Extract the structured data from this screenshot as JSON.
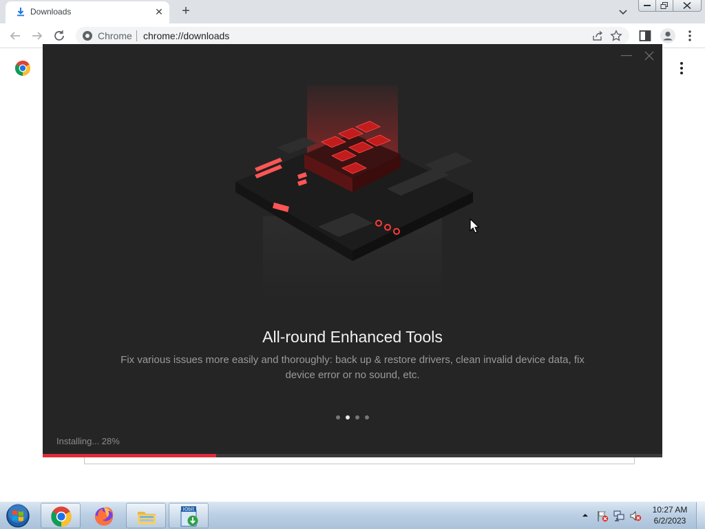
{
  "browser": {
    "tab": {
      "title": "Downloads",
      "icon": "download-icon"
    },
    "omnibox": {
      "chip": "Chrome",
      "url": "chrome://downloads"
    },
    "accent": "#1a73e8"
  },
  "installer": {
    "slide_title": "All-round Enhanced Tools",
    "slide_description": "Fix various issues more easily and thoroughly: back up & restore drivers, clean invalid device data, fix device error or no sound, etc.",
    "slides": {
      "count": 4,
      "active_index": 1
    },
    "status_text": "Installing... 28%",
    "progress": 0.28,
    "accent": "#e02c3a",
    "background": "#252525"
  },
  "taskbar": {
    "apps": [
      {
        "name": "Google Chrome",
        "icon": "chrome-icon",
        "active": true
      },
      {
        "name": "Firefox",
        "icon": "firefox-icon",
        "active": false
      },
      {
        "name": "Windows Explorer",
        "icon": "folder-icon",
        "active": true
      },
      {
        "name": "IObit installer",
        "icon": "iobit-installer-icon",
        "active": true
      }
    ],
    "app_badge": "IObit",
    "clock": {
      "time": "10:27 AM",
      "date": "6/2/2023"
    }
  }
}
